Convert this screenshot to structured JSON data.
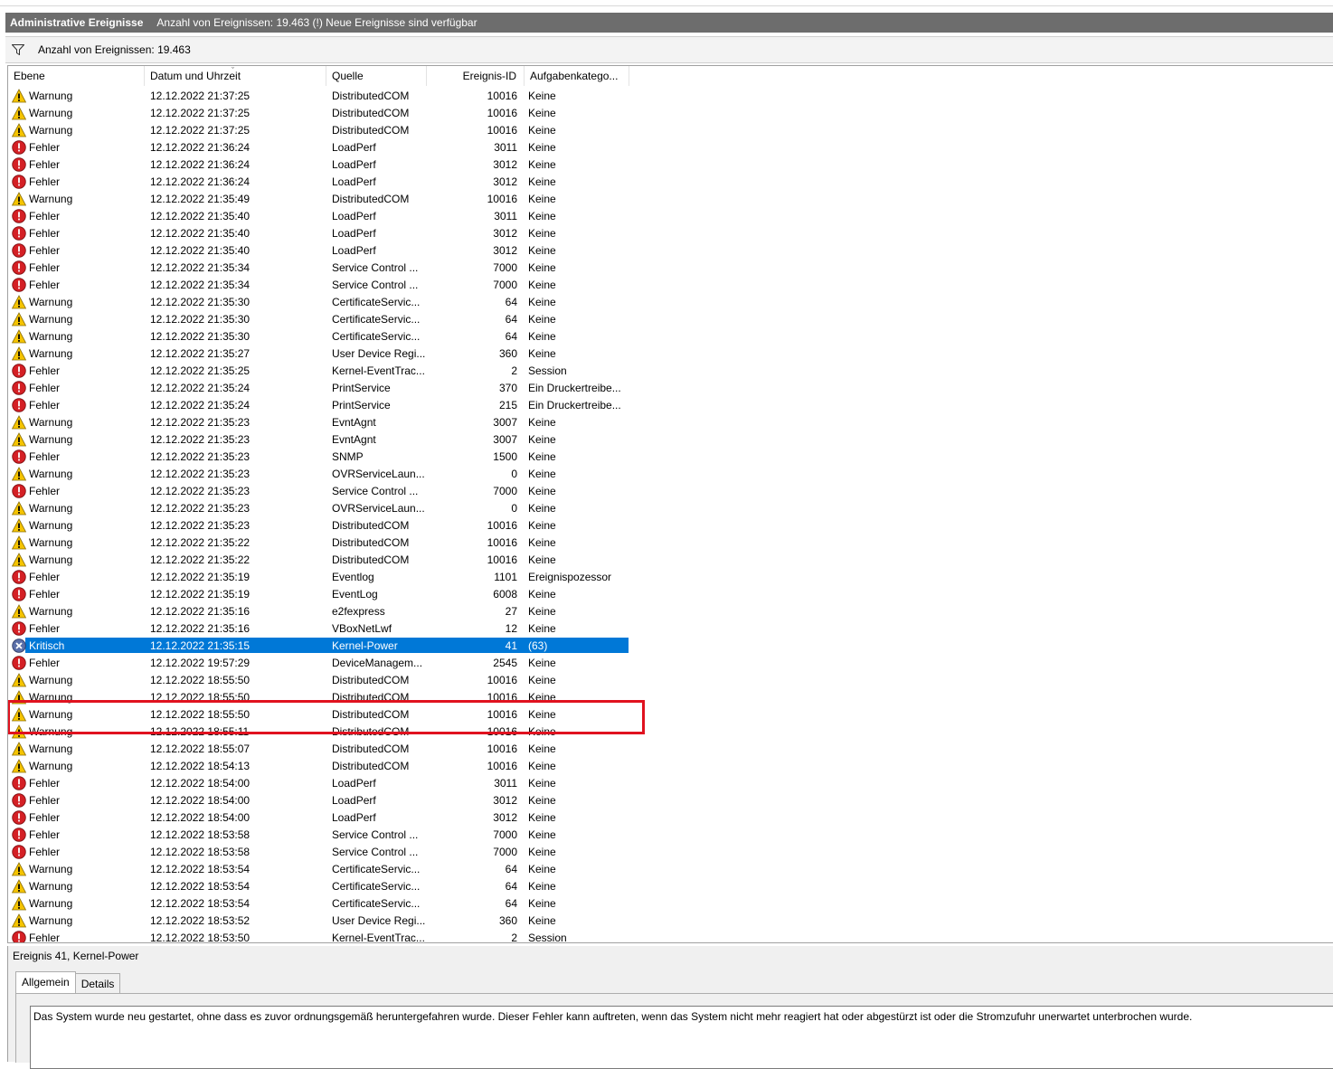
{
  "header": {
    "title": "Administrative Ereignisse",
    "status": "Anzahl von Ereignissen: 19.463 (!) Neue Ereignisse sind verfügbar"
  },
  "filter": {
    "icon": "funnel-icon",
    "text": "Anzahl von Ereignissen: 19.463"
  },
  "columns": [
    "Ebene",
    "Datum und Uhrzeit",
    "Quelle",
    "Ereignis-ID",
    "Aufgabenkatego..."
  ],
  "levels": {
    "warning": "Warnung",
    "error": "Fehler",
    "critical": "Kritisch"
  },
  "colors": {
    "selection": "#0078d7",
    "highlight": "#e0121f",
    "warning": "#f5c400",
    "error": "#d42025"
  },
  "events": [
    {
      "level": "Warnung",
      "type": "warning",
      "date": "12.12.2022 21:37:25",
      "source": "DistributedCOM",
      "id": "10016",
      "category": "Keine"
    },
    {
      "level": "Warnung",
      "type": "warning",
      "date": "12.12.2022 21:37:25",
      "source": "DistributedCOM",
      "id": "10016",
      "category": "Keine"
    },
    {
      "level": "Warnung",
      "type": "warning",
      "date": "12.12.2022 21:37:25",
      "source": "DistributedCOM",
      "id": "10016",
      "category": "Keine"
    },
    {
      "level": "Fehler",
      "type": "error",
      "date": "12.12.2022 21:36:24",
      "source": "LoadPerf",
      "id": "3011",
      "category": "Keine"
    },
    {
      "level": "Fehler",
      "type": "error",
      "date": "12.12.2022 21:36:24",
      "source": "LoadPerf",
      "id": "3012",
      "category": "Keine"
    },
    {
      "level": "Fehler",
      "type": "error",
      "date": "12.12.2022 21:36:24",
      "source": "LoadPerf",
      "id": "3012",
      "category": "Keine"
    },
    {
      "level": "Warnung",
      "type": "warning",
      "date": "12.12.2022 21:35:49",
      "source": "DistributedCOM",
      "id": "10016",
      "category": "Keine"
    },
    {
      "level": "Fehler",
      "type": "error",
      "date": "12.12.2022 21:35:40",
      "source": "LoadPerf",
      "id": "3011",
      "category": "Keine"
    },
    {
      "level": "Fehler",
      "type": "error",
      "date": "12.12.2022 21:35:40",
      "source": "LoadPerf",
      "id": "3012",
      "category": "Keine"
    },
    {
      "level": "Fehler",
      "type": "error",
      "date": "12.12.2022 21:35:40",
      "source": "LoadPerf",
      "id": "3012",
      "category": "Keine"
    },
    {
      "level": "Fehler",
      "type": "error",
      "date": "12.12.2022 21:35:34",
      "source": "Service Control ...",
      "id": "7000",
      "category": "Keine"
    },
    {
      "level": "Fehler",
      "type": "error",
      "date": "12.12.2022 21:35:34",
      "source": "Service Control ...",
      "id": "7000",
      "category": "Keine"
    },
    {
      "level": "Warnung",
      "type": "warning",
      "date": "12.12.2022 21:35:30",
      "source": "CertificateServic...",
      "id": "64",
      "category": "Keine"
    },
    {
      "level": "Warnung",
      "type": "warning",
      "date": "12.12.2022 21:35:30",
      "source": "CertificateServic...",
      "id": "64",
      "category": "Keine"
    },
    {
      "level": "Warnung",
      "type": "warning",
      "date": "12.12.2022 21:35:30",
      "source": "CertificateServic...",
      "id": "64",
      "category": "Keine"
    },
    {
      "level": "Warnung",
      "type": "warning",
      "date": "12.12.2022 21:35:27",
      "source": "User Device Regi...",
      "id": "360",
      "category": "Keine"
    },
    {
      "level": "Fehler",
      "type": "error",
      "date": "12.12.2022 21:35:25",
      "source": "Kernel-EventTrac...",
      "id": "2",
      "category": "Session"
    },
    {
      "level": "Fehler",
      "type": "error",
      "date": "12.12.2022 21:35:24",
      "source": "PrintService",
      "id": "370",
      "category": "Ein Druckertreibe..."
    },
    {
      "level": "Fehler",
      "type": "error",
      "date": "12.12.2022 21:35:24",
      "source": "PrintService",
      "id": "215",
      "category": "Ein Druckertreibe..."
    },
    {
      "level": "Warnung",
      "type": "warning",
      "date": "12.12.2022 21:35:23",
      "source": "EvntAgnt",
      "id": "3007",
      "category": "Keine"
    },
    {
      "level": "Warnung",
      "type": "warning",
      "date": "12.12.2022 21:35:23",
      "source": "EvntAgnt",
      "id": "3007",
      "category": "Keine"
    },
    {
      "level": "Fehler",
      "type": "error",
      "date": "12.12.2022 21:35:23",
      "source": "SNMP",
      "id": "1500",
      "category": "Keine"
    },
    {
      "level": "Warnung",
      "type": "warning",
      "date": "12.12.2022 21:35:23",
      "source": "OVRServiceLaun...",
      "id": "0",
      "category": "Keine"
    },
    {
      "level": "Fehler",
      "type": "error",
      "date": "12.12.2022 21:35:23",
      "source": "Service Control ...",
      "id": "7000",
      "category": "Keine"
    },
    {
      "level": "Warnung",
      "type": "warning",
      "date": "12.12.2022 21:35:23",
      "source": "OVRServiceLaun...",
      "id": "0",
      "category": "Keine"
    },
    {
      "level": "Warnung",
      "type": "warning",
      "date": "12.12.2022 21:35:23",
      "source": "DistributedCOM",
      "id": "10016",
      "category": "Keine"
    },
    {
      "level": "Warnung",
      "type": "warning",
      "date": "12.12.2022 21:35:22",
      "source": "DistributedCOM",
      "id": "10016",
      "category": "Keine"
    },
    {
      "level": "Warnung",
      "type": "warning",
      "date": "12.12.2022 21:35:22",
      "source": "DistributedCOM",
      "id": "10016",
      "category": "Keine"
    },
    {
      "level": "Fehler",
      "type": "error",
      "date": "12.12.2022 21:35:19",
      "source": "Eventlog",
      "id": "1101",
      "category": "Ereignispozessor"
    },
    {
      "level": "Fehler",
      "type": "error",
      "date": "12.12.2022 21:35:19",
      "source": "EventLog",
      "id": "6008",
      "category": "Keine"
    },
    {
      "level": "Warnung",
      "type": "warning",
      "date": "12.12.2022 21:35:16",
      "source": "e2fexpress",
      "id": "27",
      "category": "Keine"
    },
    {
      "level": "Fehler",
      "type": "error",
      "date": "12.12.2022 21:35:16",
      "source": "VBoxNetLwf",
      "id": "12",
      "category": "Keine"
    },
    {
      "level": "Kritisch",
      "type": "critical",
      "date": "12.12.2022 21:35:15",
      "source": "Kernel-Power",
      "id": "41",
      "category": "(63)",
      "selected": true
    },
    {
      "level": "Fehler",
      "type": "error",
      "date": "12.12.2022 19:57:29",
      "source": "DeviceManagem...",
      "id": "2545",
      "category": "Keine"
    },
    {
      "level": "Warnung",
      "type": "warning",
      "date": "12.12.2022 18:55:50",
      "source": "DistributedCOM",
      "id": "10016",
      "category": "Keine"
    },
    {
      "level": "Warnung",
      "type": "warning",
      "date": "12.12.2022 18:55:50",
      "source": "DistributedCOM",
      "id": "10016",
      "category": "Keine"
    },
    {
      "level": "Warnung",
      "type": "warning",
      "date": "12.12.2022 18:55:50",
      "source": "DistributedCOM",
      "id": "10016",
      "category": "Keine"
    },
    {
      "level": "Warnung",
      "type": "warning",
      "date": "12.12.2022 18:55:11",
      "source": "DistributedCOM",
      "id": "10016",
      "category": "Keine"
    },
    {
      "level": "Warnung",
      "type": "warning",
      "date": "12.12.2022 18:55:07",
      "source": "DistributedCOM",
      "id": "10016",
      "category": "Keine"
    },
    {
      "level": "Warnung",
      "type": "warning",
      "date": "12.12.2022 18:54:13",
      "source": "DistributedCOM",
      "id": "10016",
      "category": "Keine"
    },
    {
      "level": "Fehler",
      "type": "error",
      "date": "12.12.2022 18:54:00",
      "source": "LoadPerf",
      "id": "3011",
      "category": "Keine"
    },
    {
      "level": "Fehler",
      "type": "error",
      "date": "12.12.2022 18:54:00",
      "source": "LoadPerf",
      "id": "3012",
      "category": "Keine"
    },
    {
      "level": "Fehler",
      "type": "error",
      "date": "12.12.2022 18:54:00",
      "source": "LoadPerf",
      "id": "3012",
      "category": "Keine"
    },
    {
      "level": "Fehler",
      "type": "error",
      "date": "12.12.2022 18:53:58",
      "source": "Service Control ...",
      "id": "7000",
      "category": "Keine"
    },
    {
      "level": "Fehler",
      "type": "error",
      "date": "12.12.2022 18:53:58",
      "source": "Service Control ...",
      "id": "7000",
      "category": "Keine"
    },
    {
      "level": "Warnung",
      "type": "warning",
      "date": "12.12.2022 18:53:54",
      "source": "CertificateServic...",
      "id": "64",
      "category": "Keine"
    },
    {
      "level": "Warnung",
      "type": "warning",
      "date": "12.12.2022 18:53:54",
      "source": "CertificateServic...",
      "id": "64",
      "category": "Keine"
    },
    {
      "level": "Warnung",
      "type": "warning",
      "date": "12.12.2022 18:53:54",
      "source": "CertificateServic...",
      "id": "64",
      "category": "Keine"
    },
    {
      "level": "Warnung",
      "type": "warning",
      "date": "12.12.2022 18:53:52",
      "source": "User Device Regi...",
      "id": "360",
      "category": "Keine"
    },
    {
      "level": "Fehler",
      "type": "error",
      "date": "12.12.2022 18:53:50",
      "source": "Kernel-EventTrac...",
      "id": "2",
      "category": "Session"
    }
  ],
  "detail": {
    "title": "Ereignis 41, Kernel-Power",
    "tabs": [
      "Allgemein",
      "Details"
    ],
    "message": "Das System wurde neu gestartet, ohne dass es zuvor ordnungsgemäß heruntergefahren wurde. Dieser Fehler kann auftreten, wenn das System nicht mehr reagiert hat oder abgestürzt ist oder die Stromzufuhr unerwartet unterbrochen wurde."
  }
}
